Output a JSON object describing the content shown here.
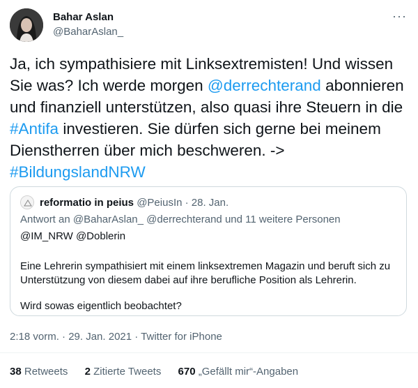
{
  "author": {
    "name": "Bahar Aslan",
    "handle": "@BaharAslan_",
    "more_icon": "more-icon"
  },
  "tweet": {
    "part1": "Ja, ich sympathisiere mit Linksextremisten! Und wissen Sie was? Ich werde morgen ",
    "mention": "@derrechterand",
    "part2": " abonnieren und finanziell unterstützen, also quasi ihre Steuern in die ",
    "hashtag1": "#Antifa",
    "part3": " investieren. Sie dürfen sich gerne bei meinem Dienstherren über mich beschweren. -> ",
    "hashtag2": "#BildungslandNRW"
  },
  "quote": {
    "name": "reformatio in peius",
    "meta": "@PeiusIn · 28. Jan.",
    "reply_to": "Antwort an @BaharAslan_ @derrechterand und 11 weitere Personen",
    "mentions": "@IM_NRW @Doblerin",
    "body": "Eine Lehrerin sympathisiert mit einem linksextremen Magazin und beruft sich zu Unterstützung von diesem dabei auf ihre berufliche Position als Lehrerin.",
    "question": "Wird sowas eigentlich beobachtet?"
  },
  "timestamp": "2:18 vorm. · 29. Jan. 2021 · Twitter for iPhone",
  "stats": {
    "retweets_count": "38",
    "retweets_label": "Retweets",
    "quotes_count": "2",
    "quotes_label": "Zitierte Tweets",
    "likes_count": "670",
    "likes_label": "„Gefällt mir“-Angaben"
  },
  "colors": {
    "link": "#1d9bf0",
    "secondary": "#536471",
    "border": "#cfd9de"
  }
}
